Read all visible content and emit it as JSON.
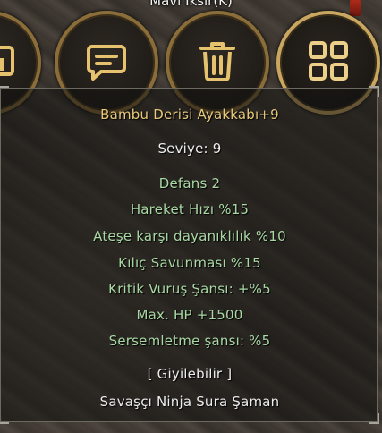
{
  "header": {
    "selected_item_name": "Mavi İksir(K)"
  },
  "action_buttons": [
    {
      "name": "character",
      "icon": "character-icon"
    },
    {
      "name": "chat",
      "icon": "chat-icon"
    },
    {
      "name": "delete",
      "icon": "trash-icon"
    },
    {
      "name": "inventory",
      "icon": "grid-icon"
    }
  ],
  "tooltip": {
    "item_name": "Bambu Derisi Ayakkabı+9",
    "level": "Seviye: 9",
    "defense": "Defans 2",
    "bonuses": [
      "Hareket Hızı %15",
      "Ateşe karşı dayanıklılık %10",
      "Kılıç Savunması %15",
      "Kritik Vuruş Şansı: +%5",
      "Max. HP +1500",
      "Sersemletme şansı: %5"
    ],
    "wearable": "[ Giyilebilir ]",
    "classes": "Savaşçı Ninja Sura Şaman"
  },
  "colors": {
    "item_name": "#e8c87a",
    "bonus_text": "#a9d8a4",
    "plain_text": "#ececec",
    "button_rim": "#8a6d38",
    "button_rim_active": "#c9a760"
  }
}
